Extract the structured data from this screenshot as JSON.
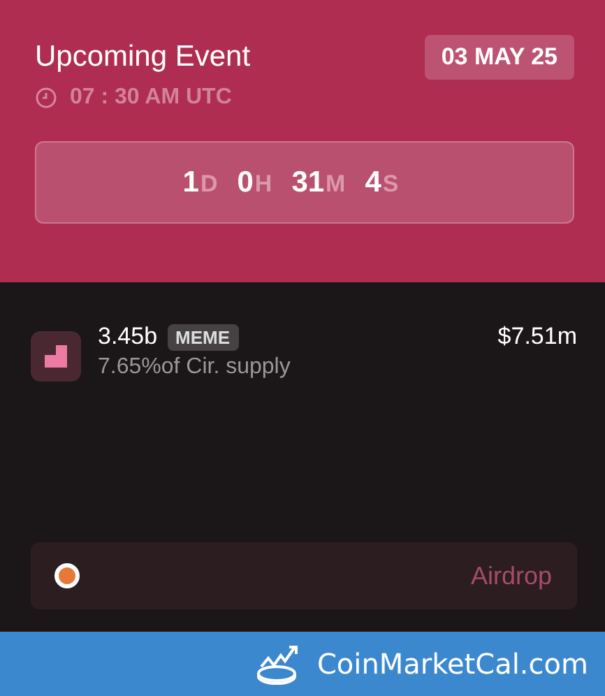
{
  "event": {
    "title": "Upcoming Event",
    "date": "03 MAY 25",
    "time": "07 : 30 AM UTC",
    "countdown": [
      {
        "value": "1",
        "unit": "D"
      },
      {
        "value": "0",
        "unit": "H"
      },
      {
        "value": "31",
        "unit": "M"
      },
      {
        "value": "4",
        "unit": "S"
      }
    ]
  },
  "token": {
    "amount": "3.45b",
    "tag": "MEME",
    "supply": "7.65%of Cir. supply",
    "value": "$7.51m"
  },
  "category": {
    "label": "Airdrop",
    "color": "#e8773a"
  },
  "footer": {
    "brand": "CoinMarketCal.com"
  }
}
